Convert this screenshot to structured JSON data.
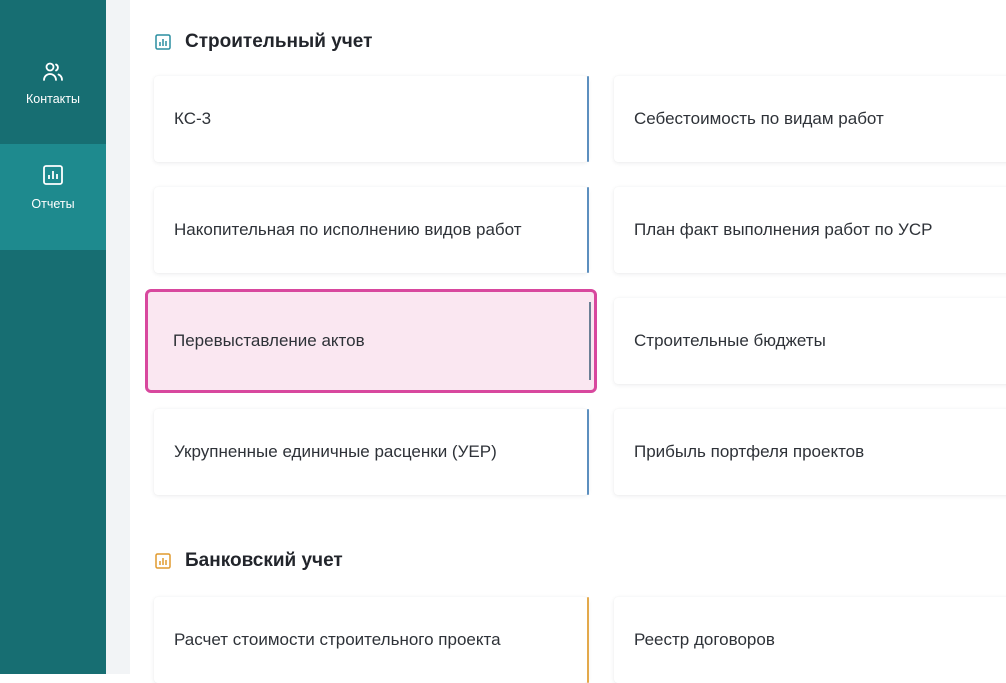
{
  "sidebar": {
    "items": [
      {
        "label": "Контакты",
        "icon": "users-icon",
        "active": false
      },
      {
        "label": "Отчеты",
        "icon": "report-chart-icon",
        "active": true
      }
    ]
  },
  "sections": [
    {
      "title": "Строительный учет",
      "icon_color": "#2a8ea0",
      "rows": [
        {
          "left": "КС-3",
          "right": "Себестоимость по видам работ"
        },
        {
          "left": "Накопительная по исполнению видов работ",
          "right": "План факт выполнения работ по УСР"
        },
        {
          "left": "Перевыставление актов",
          "right": "Строительные бюджеты",
          "highlighted": true
        },
        {
          "left": "Укрупненные единичные расценки (УЕР)",
          "right": "Прибыль портфеля проектов"
        }
      ]
    },
    {
      "title": "Банковский учет",
      "icon_color": "#e09a2e",
      "rows": [
        {
          "left": "Расчет стоимости строительного проекта",
          "right": "Реестр договоров"
        }
      ]
    }
  ],
  "colors": {
    "sidebar_bg": "#176e72",
    "sidebar_active": "#1e8a8e",
    "highlight_border": "#d8489e",
    "highlight_bg": "#fae7f1",
    "accent_blue": "#5c8fbf",
    "accent_orange": "#e3a94b"
  }
}
